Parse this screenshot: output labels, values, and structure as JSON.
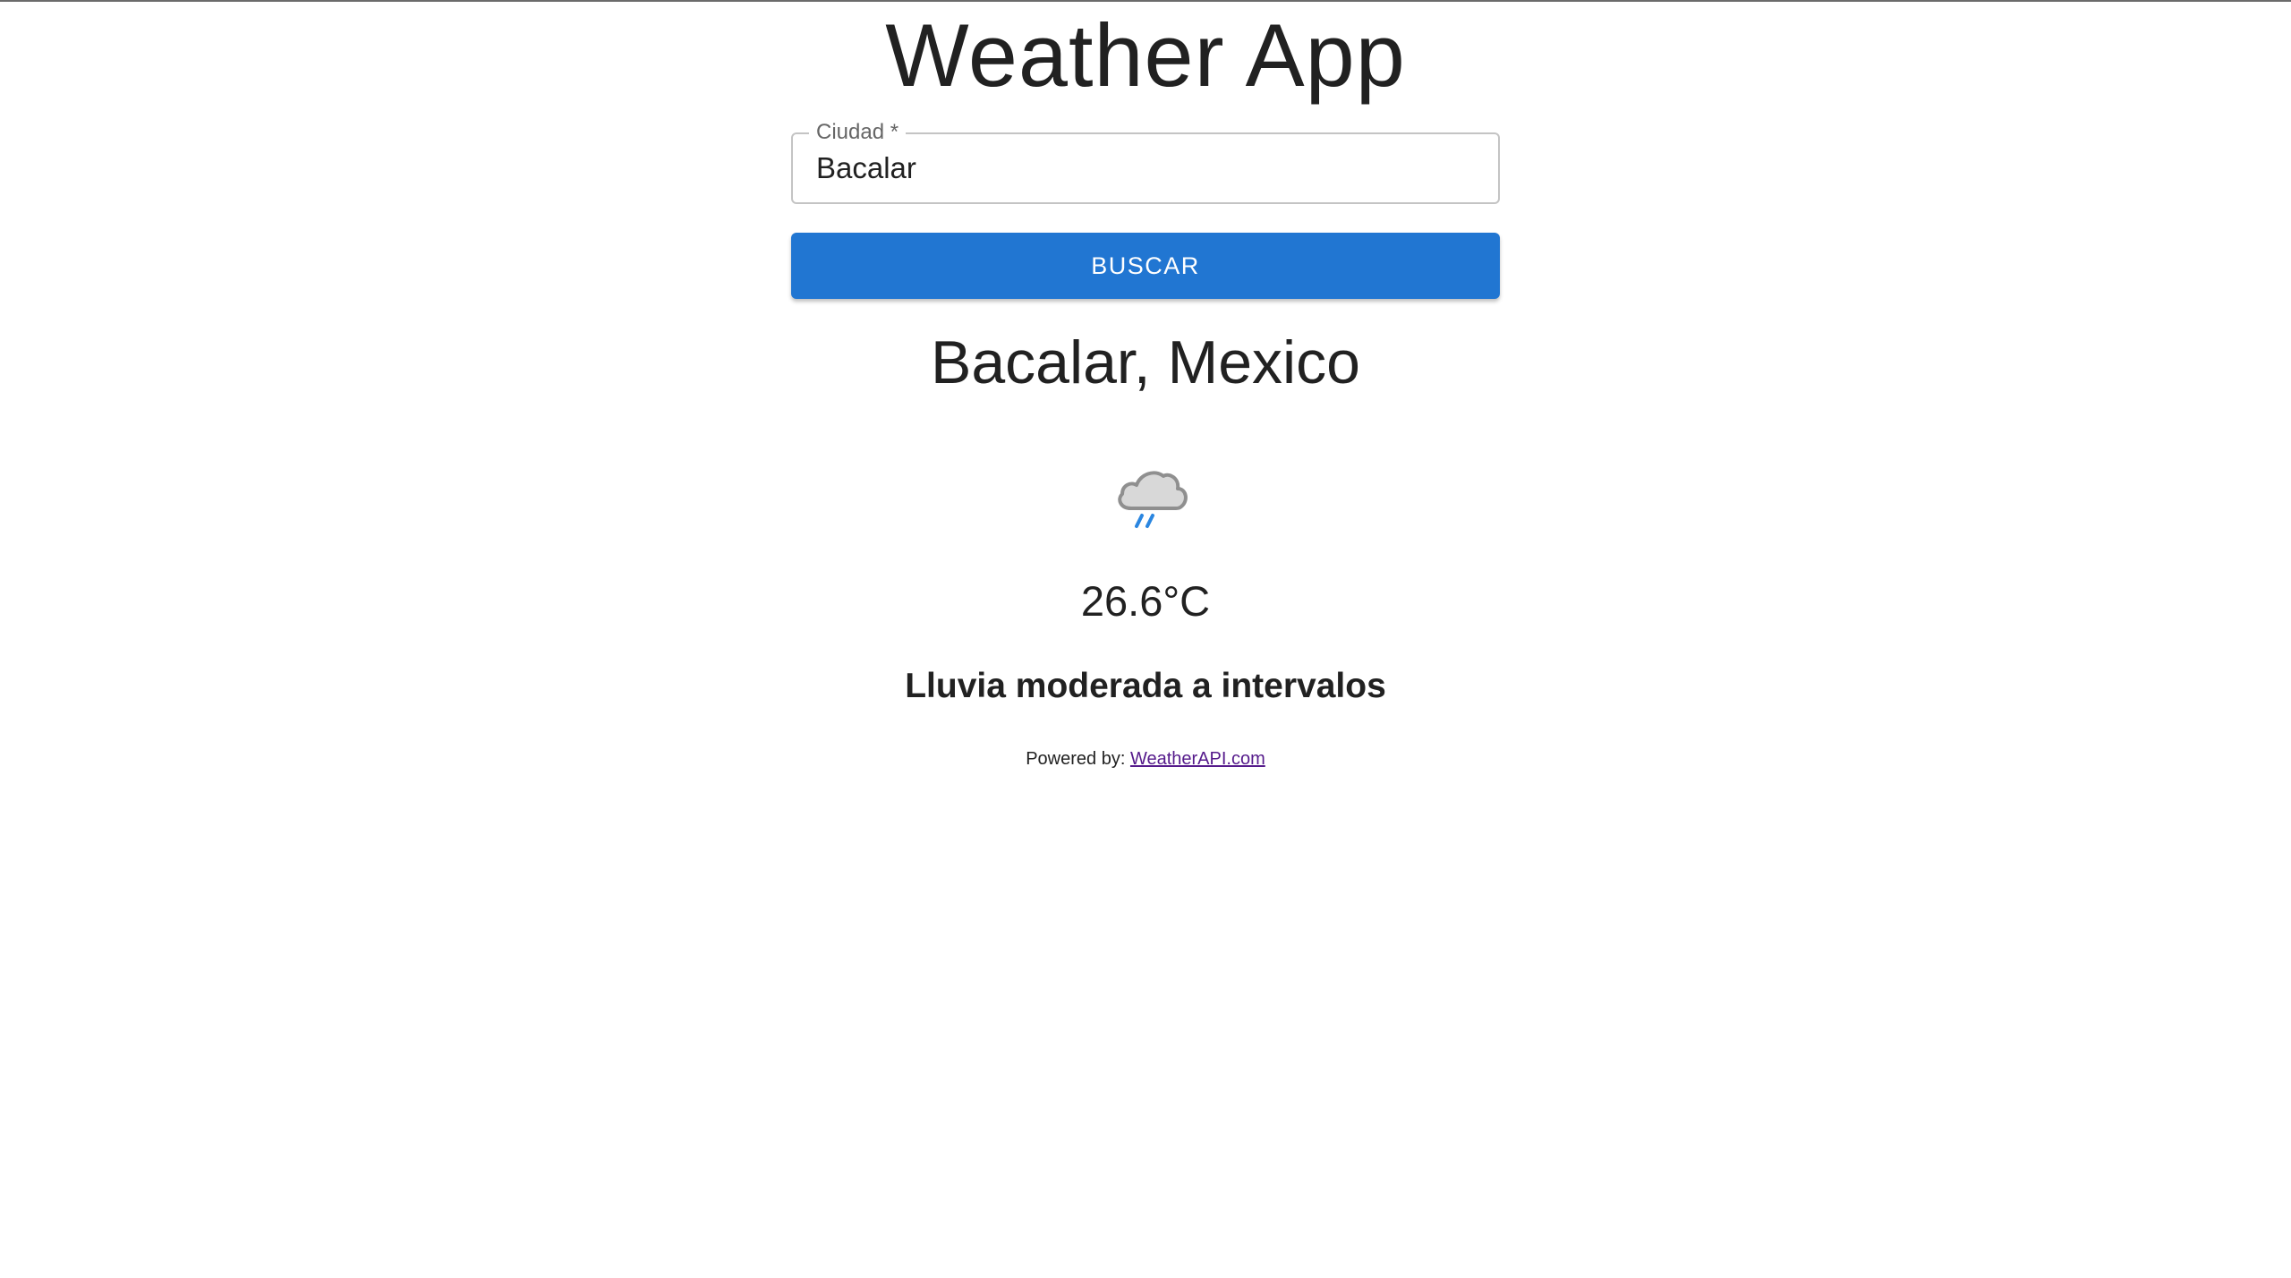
{
  "app": {
    "title": "Weather App"
  },
  "search": {
    "label": "Ciudad *",
    "value": "Bacalar",
    "button_label": "BUSCAR"
  },
  "result": {
    "location": "Bacalar, Mexico",
    "icon": "moon-cloud-rain-icon",
    "temperature": "26.6°C",
    "condition": "Lluvia moderada a intervalos"
  },
  "footer": {
    "powered_by_label": "Powered by:",
    "link_text": "WeatherAPI.com"
  },
  "colors": {
    "accent": "#2176d2",
    "text": "#212121",
    "link_visited": "#551a8b"
  }
}
